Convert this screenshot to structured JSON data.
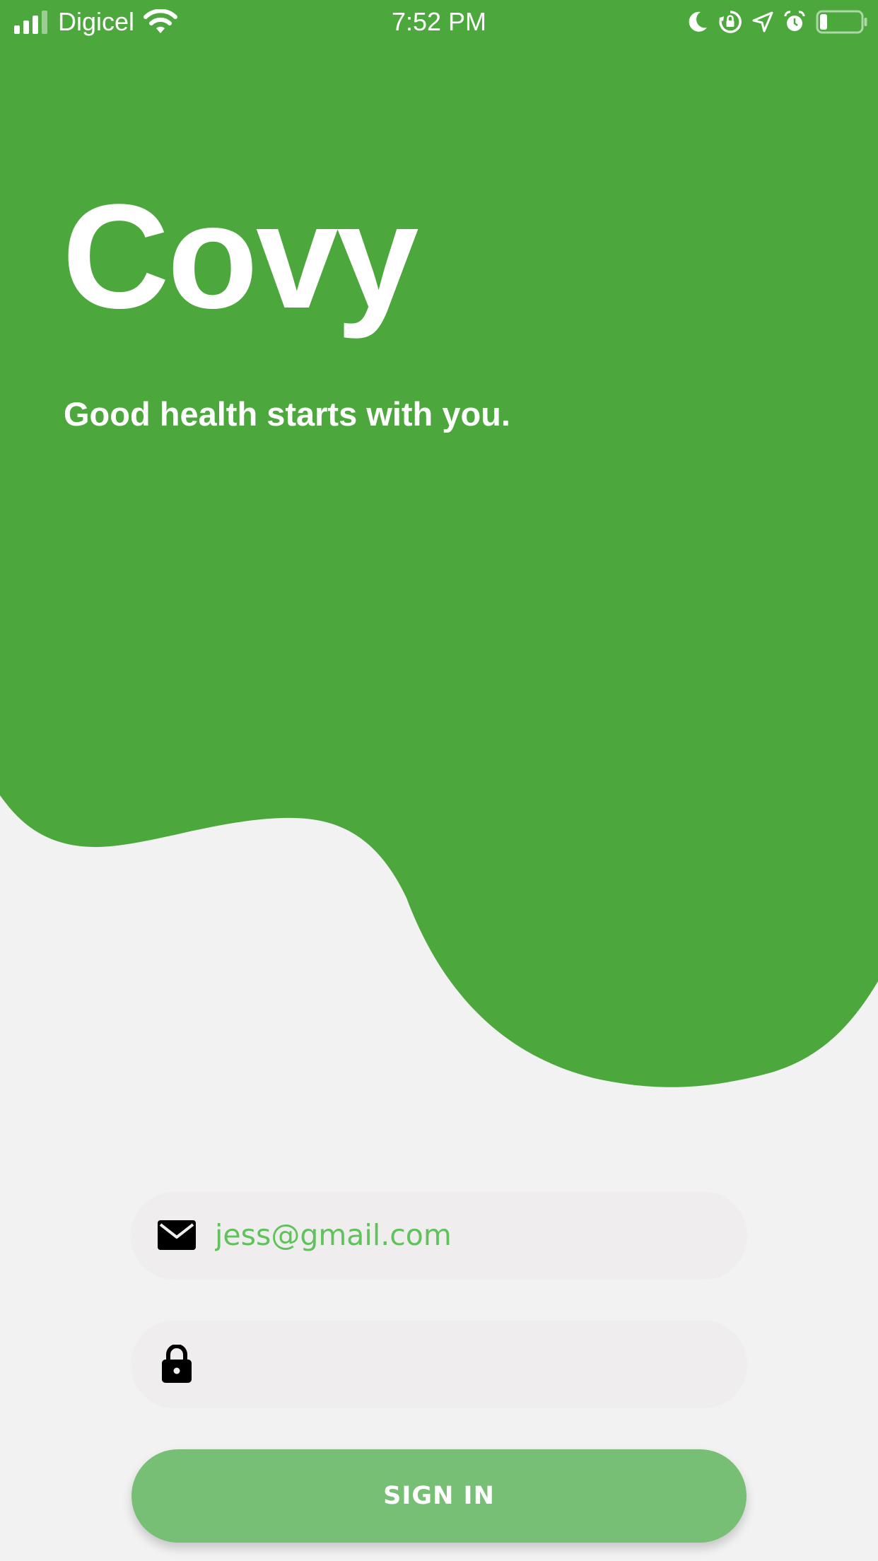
{
  "status_bar": {
    "carrier": "Digicel",
    "time": "7:52 PM",
    "icons": [
      "signal-icon",
      "wifi-icon",
      "moon-icon",
      "rotation-lock-icon",
      "location-icon",
      "alarm-icon",
      "battery-icon"
    ],
    "battery_level": 0.18
  },
  "hero": {
    "title": "Covy",
    "tagline": "Good health starts with you.",
    "background_color": "#4ca73c",
    "page_background": "#f2f2f2"
  },
  "login_form": {
    "email": {
      "icon": "mail-icon",
      "value": "jess@gmail.com",
      "value_color": "#5fc25a"
    },
    "password": {
      "icon": "lock-icon",
      "value": ""
    },
    "sign_in_label": "SIGN IN",
    "button_color": "#76bf74"
  }
}
